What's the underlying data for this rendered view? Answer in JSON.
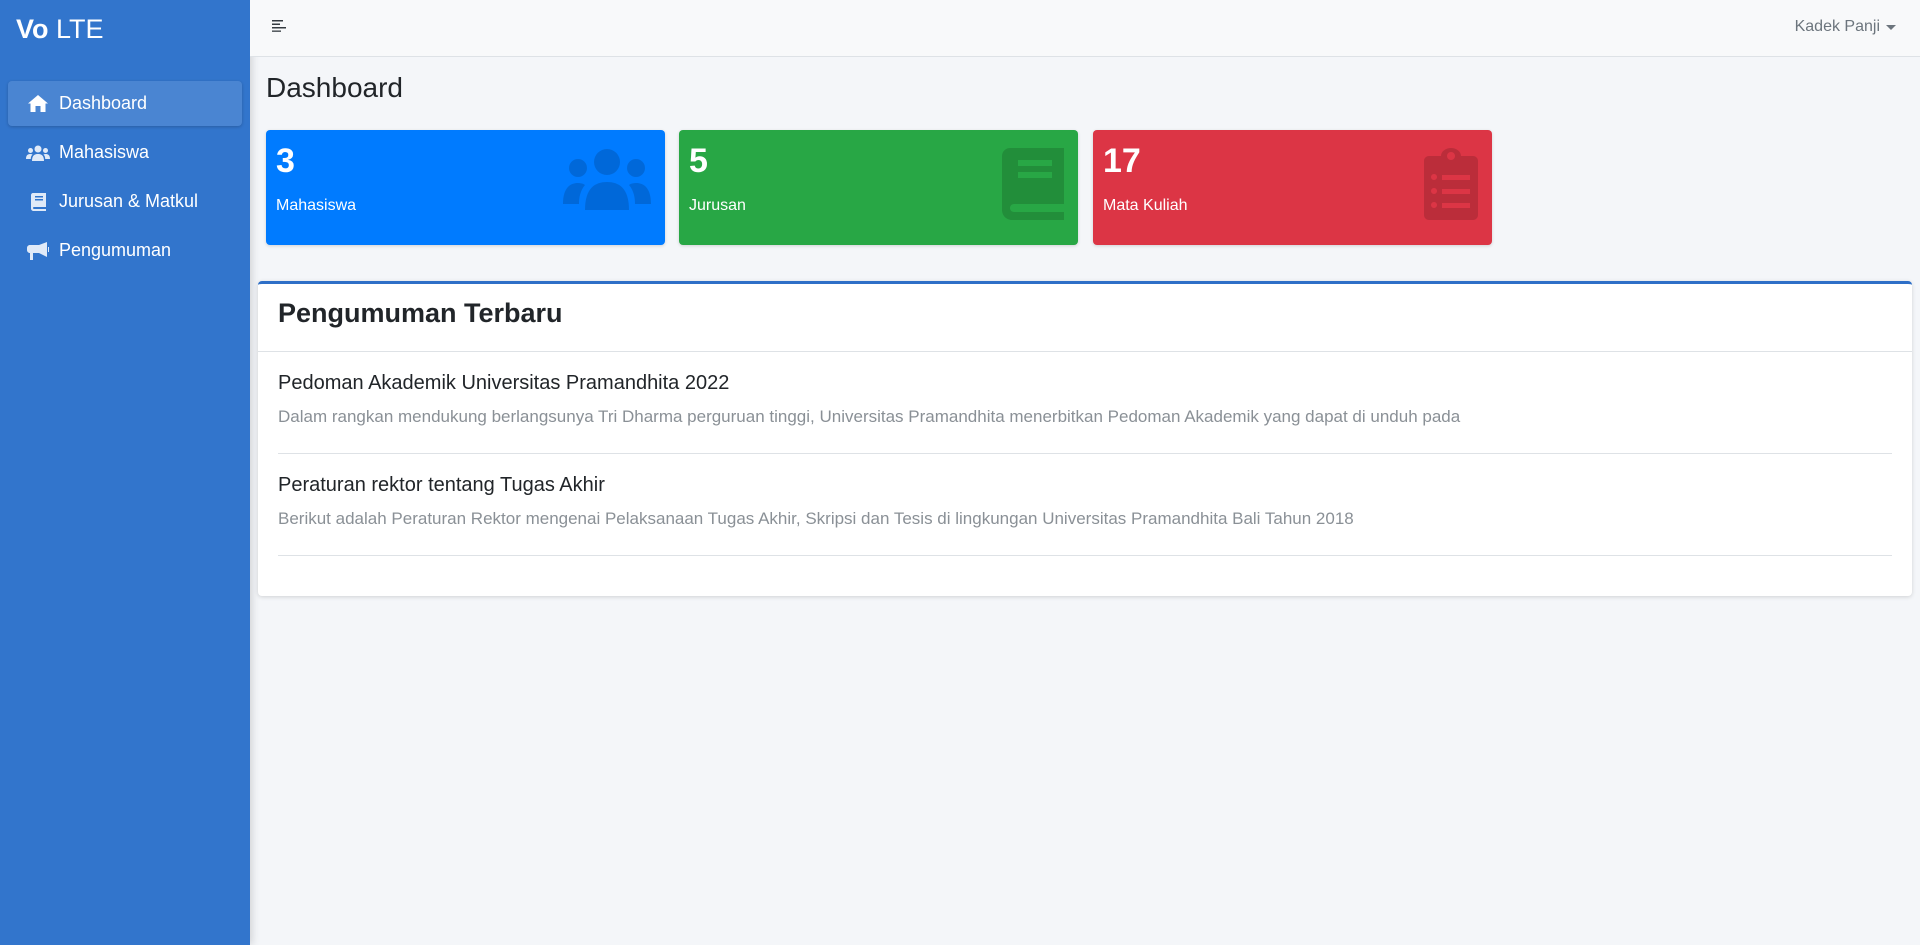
{
  "brand": {
    "bold": "Vo",
    "light": "LTE"
  },
  "sidebar": {
    "items": [
      {
        "label": "Dashboard",
        "icon": "home-icon",
        "active": true
      },
      {
        "label": "Mahasiswa",
        "icon": "users-icon",
        "active": false
      },
      {
        "label": "Jurusan & Matkul",
        "icon": "book-icon",
        "active": false
      },
      {
        "label": "Pengumuman",
        "icon": "bullhorn-icon",
        "active": false
      }
    ]
  },
  "topbar": {
    "user_name": "Kadek Panji"
  },
  "page": {
    "title": "Dashboard"
  },
  "stats": [
    {
      "value": "3",
      "label": "Mahasiswa",
      "color": "#007bff",
      "icon": "users-icon"
    },
    {
      "value": "5",
      "label": "Jurusan",
      "color": "#28a745",
      "icon": "book-icon"
    },
    {
      "value": "17",
      "label": "Mata Kuliah",
      "color": "#dc3545",
      "icon": "clipboard-list-icon"
    }
  ],
  "announcements": {
    "title": "Pengumuman Terbaru",
    "items": [
      {
        "title": "Pedoman Akademik Universitas Pramandhita 2022",
        "text": "Dalam rangkan mendukung berlangsunya Tri Dharma perguruan tinggi, Universitas Pramandhita menerbitkan Pedoman Akademik yang dapat di unduh pada"
      },
      {
        "title": "Peraturan rektor tentang Tugas Akhir",
        "text": "Berikut adalah Peraturan Rektor mengenai Pelaksanaan Tugas Akhir, Skripsi dan Tesis di lingkungan Universitas Pramandhita Bali Tahun 2018"
      }
    ]
  }
}
